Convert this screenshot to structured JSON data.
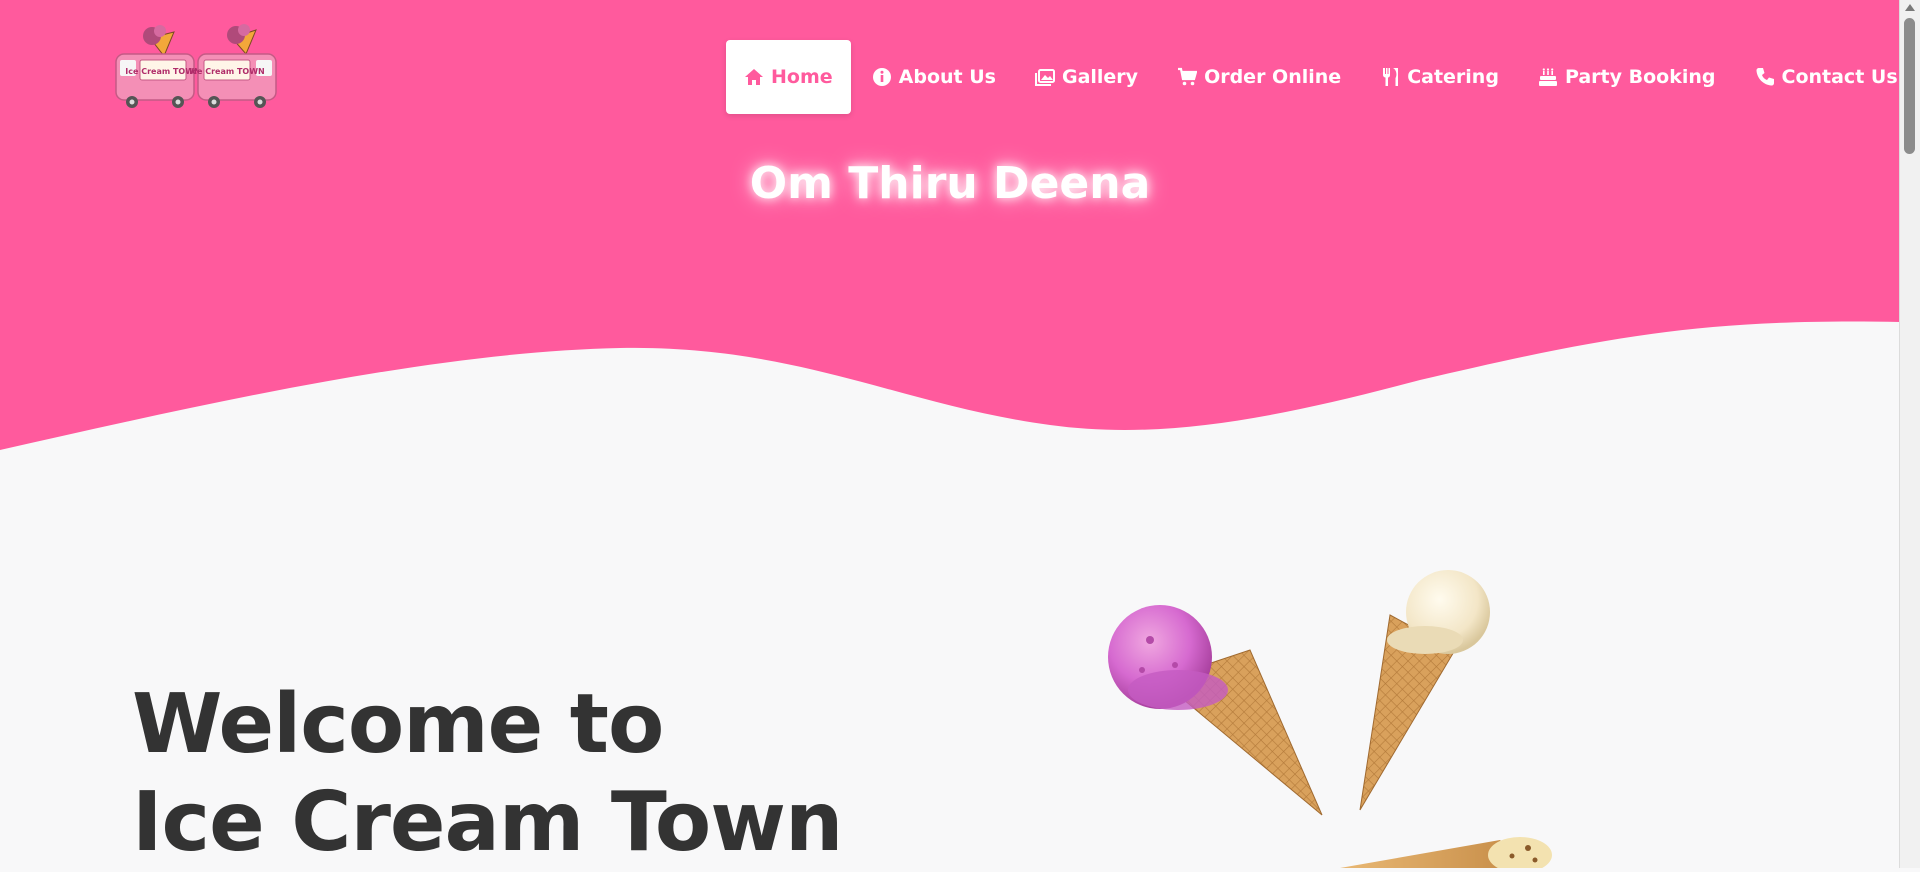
{
  "colors": {
    "brand_pink": "#ff5a9d",
    "page_bg": "#f8f8f9",
    "heading": "#333333"
  },
  "logo": {
    "icon": "ice-cream-truck-logo",
    "text_left": "Ice Cream TOWN",
    "text_right": "Ice Cream TOWN"
  },
  "nav": {
    "items": [
      {
        "label": "Home",
        "icon": "home-icon",
        "active": true
      },
      {
        "label": "About Us",
        "icon": "info-icon"
      },
      {
        "label": "Gallery",
        "icon": "image-icon"
      },
      {
        "label": "Order Online",
        "icon": "cart-icon"
      },
      {
        "label": "Catering",
        "icon": "utensils-icon"
      },
      {
        "label": "Party Booking",
        "icon": "cake-icon"
      },
      {
        "label": "Contact Us",
        "icon": "phone-icon"
      }
    ]
  },
  "brand_name": "Om Thiru Deena",
  "hero": {
    "line1": "Welcome to",
    "line2": "Ice Cream Town"
  }
}
